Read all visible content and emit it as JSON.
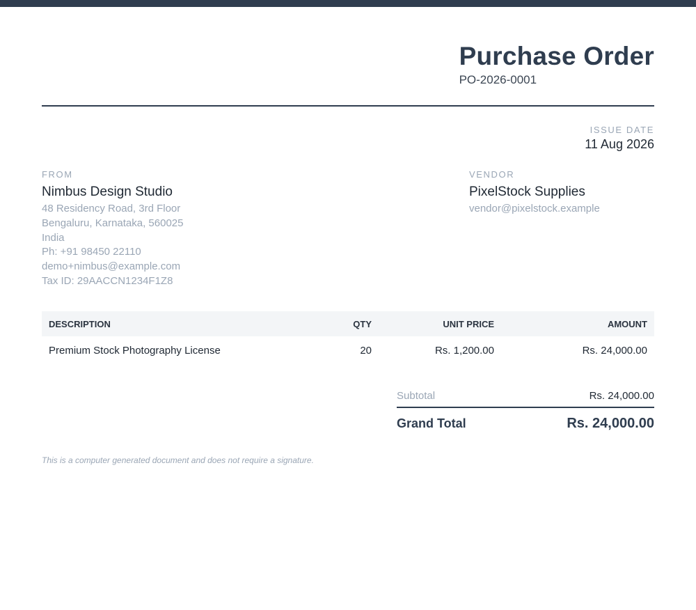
{
  "document": {
    "title": "Purchase Order",
    "number": "PO-2026-0001",
    "issue_date_label": "ISSUE DATE",
    "issue_date": "11 Aug 2026"
  },
  "from": {
    "label": "FROM",
    "name": "Nimbus Design Studio",
    "lines": [
      "48 Residency Road, 3rd Floor",
      "Bengaluru, Karnataka, 560025",
      "India",
      "Ph: +91 98450 22110",
      "demo+nimbus@example.com",
      "Tax ID: 29AACCN1234F1Z8"
    ]
  },
  "vendor": {
    "label": "VENDOR",
    "name": "PixelStock Supplies",
    "email": "vendor@pixelstock.example"
  },
  "table": {
    "headers": {
      "description": "DESCRIPTION",
      "qty": "QTY",
      "unit_price": "UNIT PRICE",
      "amount": "AMOUNT"
    },
    "rows": [
      {
        "description": "Premium Stock Photography License",
        "qty": "20",
        "unit_price": "Rs. 1,200.00",
        "amount": "Rs. 24,000.00"
      }
    ]
  },
  "totals": {
    "subtotal_label": "Subtotal",
    "subtotal_value": "Rs. 24,000.00",
    "grand_total_label": "Grand Total",
    "grand_total_value": "Rs. 24,000.00"
  },
  "footer": {
    "note": "This is a computer generated document and does not require a signature."
  },
  "colors": {
    "accent": "#2f3d4f",
    "muted": "#9aa6b5",
    "table_header_bg": "#f3f5f7"
  }
}
